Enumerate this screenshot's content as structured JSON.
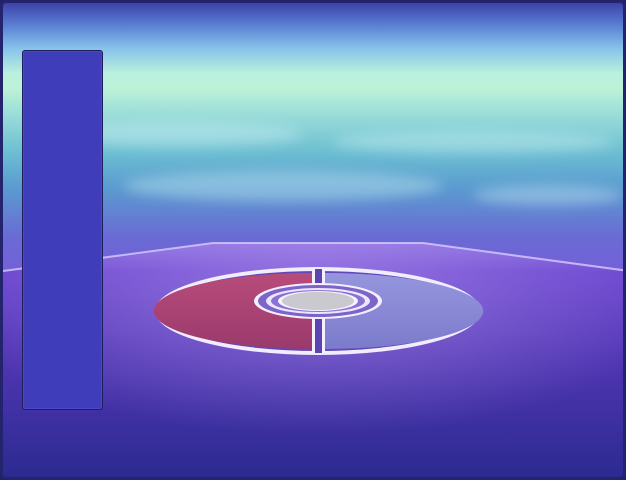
{
  "scene": {
    "type": "battle-arena",
    "elements": [
      "sky-backdrop",
      "arena-floor",
      "battle-circle",
      "side-panel"
    ]
  },
  "colors": {
    "sky_top": "#3d42a8",
    "sky_horizon": "#bdf2d8",
    "floor": "#5a3cb8",
    "circle_red": "#b04a78",
    "circle_blue": "#8a8ad6",
    "circle_center": "#c9c9cf",
    "panel": "#3f3db9",
    "frame": "#24246e"
  }
}
